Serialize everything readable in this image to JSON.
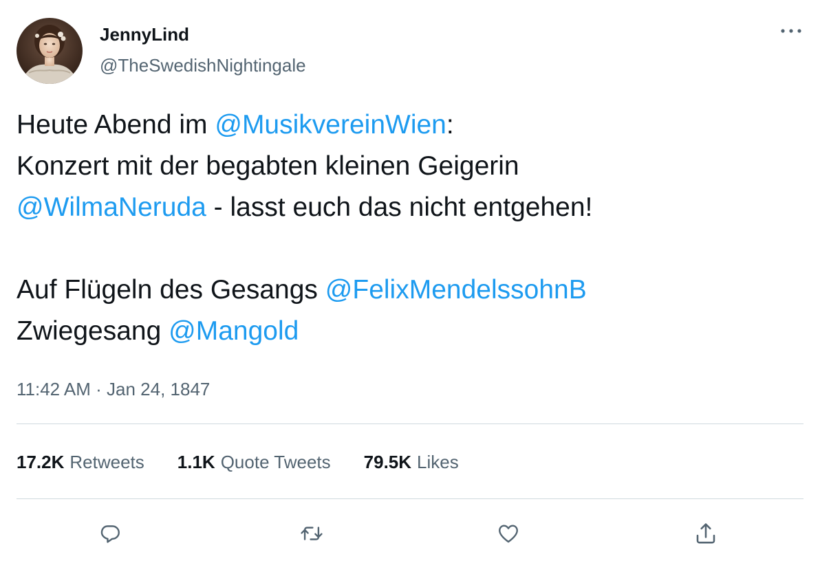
{
  "author": {
    "display_name": "JennyLind",
    "handle": "@TheSwedishNightingale"
  },
  "tweet": {
    "lines": [
      [
        {
          "text": "Heute Abend im "
        },
        {
          "text": "@MusikvereinWien",
          "mention": true
        },
        {
          "text": ":"
        }
      ],
      [
        {
          "text": "Konzert mit der begabten kleinen Geigerin"
        }
      ],
      [
        {
          "text": "@WilmaNeruda",
          "mention": true
        },
        {
          "text": " - lasst euch das nicht entgehen!"
        }
      ],
      [],
      [
        {
          "text": "Auf Flügeln des Gesangs "
        },
        {
          "text": "@FelixMendelssohnB",
          "mention": true
        }
      ],
      [
        {
          "text": "Zwiegesang "
        },
        {
          "text": "@Mangold",
          "mention": true
        }
      ]
    ],
    "timestamp": "11:42 AM · Jan 24, 1847"
  },
  "stats": {
    "retweets": {
      "count": "17.2K",
      "label": "Retweets"
    },
    "quote_tweets": {
      "count": "1.1K",
      "label": "Quote Tweets"
    },
    "likes": {
      "count": "79.5K",
      "label": "Likes"
    }
  },
  "icons": {
    "more": "more-horizontal-icon",
    "reply": "reply-icon",
    "retweet": "retweet-icon",
    "like": "heart-icon",
    "share": "share-icon"
  },
  "colors": {
    "text": "#0f1419",
    "secondary": "#536471",
    "mention": "#1d9bf0",
    "divider": "#cfd9de"
  }
}
